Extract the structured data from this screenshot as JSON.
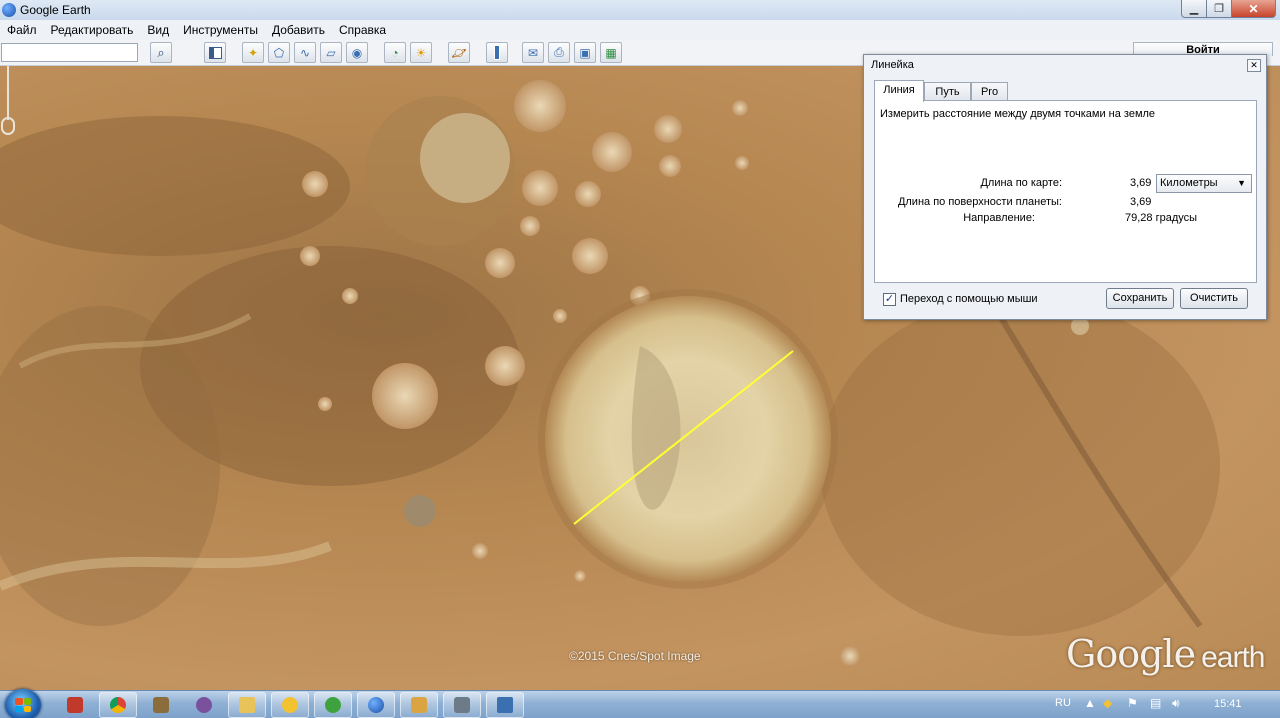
{
  "window": {
    "title": "Google Earth"
  },
  "menu": [
    "Файл",
    "Редактировать",
    "Вид",
    "Инструменты",
    "Добавить",
    "Справка"
  ],
  "toolbar": {
    "search_value": "",
    "signin_label": "Войти",
    "icons": [
      "sidebar-toggle-icon",
      "add-placemark-icon",
      "add-polygon-icon",
      "add-path-icon",
      "add-image-overlay-icon",
      "record-tour-icon",
      "historical-imagery-icon",
      "sunlight-icon",
      "switch-to-sky-icon",
      "ruler-icon",
      "email-icon",
      "print-icon",
      "save-image-icon",
      "view-in-maps-icon"
    ]
  },
  "ruler": {
    "title": "Линейка",
    "tabs": [
      "Линия",
      "Путь",
      "Pro"
    ],
    "active_tab": "Линия",
    "description": "Измерить расстояние между двумя точками на земле",
    "map_length_label": "Длина по карте:",
    "map_length_value": "3,69",
    "unit": "Километры",
    "ground_length_label": "Длина по поверхности планеты:",
    "ground_length_value": "3,69",
    "heading_label": "Направление:",
    "heading_value": "79,28 градусы",
    "mouse_nav_label": "Переход с помощью мыши",
    "mouse_nav_checked": true,
    "save_label": "Сохранить",
    "clear_label": "Очистить",
    "line_color": "#ffff33"
  },
  "map": {
    "copyright": "©2015 Cnes/Spot Image",
    "logo_text": "Google",
    "logo_sub": "earth"
  },
  "taskbar": {
    "lang": "RU",
    "clock": "15:41",
    "apps": [
      "flash-icon",
      "chrome-icon",
      "plugin-icon",
      "viber-icon",
      "explorer-icon",
      "smile-icon",
      "utorrent-icon",
      "google-earth-icon",
      "paint-icon",
      "camera-icon",
      "window-icon"
    ]
  }
}
